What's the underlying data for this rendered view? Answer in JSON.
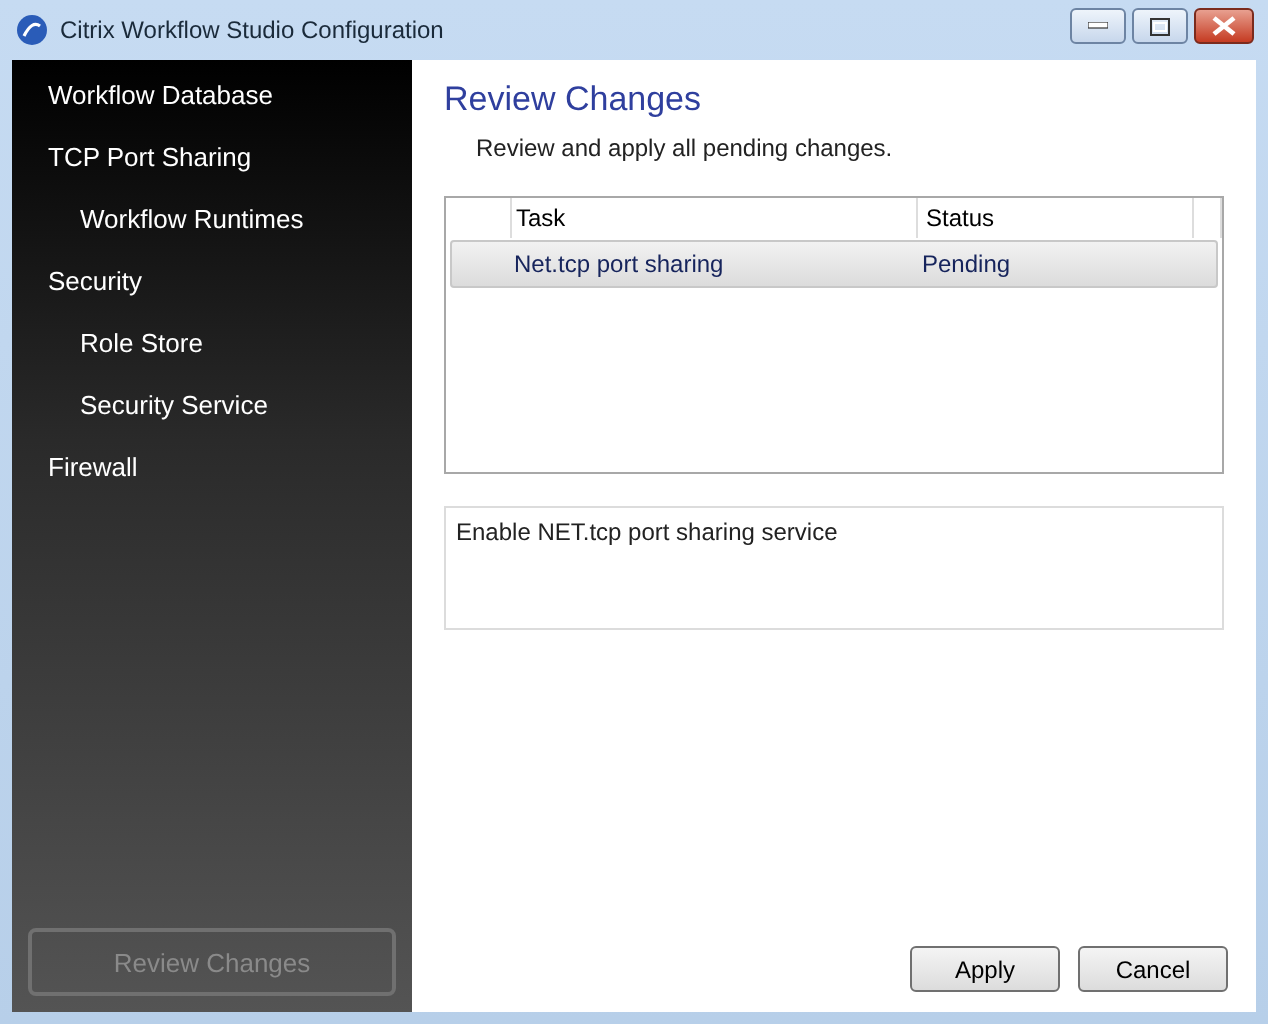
{
  "window": {
    "title": "Citrix Workflow Studio Configuration"
  },
  "sidebar": {
    "items": [
      {
        "label": "Workflow Database"
      },
      {
        "label": "TCP Port Sharing",
        "children": [
          {
            "label": "Workflow Runtimes"
          }
        ]
      },
      {
        "label": "Security",
        "children": [
          {
            "label": "Role Store"
          },
          {
            "label": "Security Service"
          }
        ]
      },
      {
        "label": "Firewall"
      }
    ],
    "button": {
      "label": "Review Changes",
      "disabled": true
    }
  },
  "page": {
    "title": "Review Changes",
    "subtitle": "Review and apply all pending changes.",
    "table": {
      "columns": [
        "Task",
        "Status"
      ],
      "rows": [
        {
          "cells": [
            "Net.tcp port sharing",
            "Pending"
          ],
          "selected": true
        }
      ]
    },
    "description": "Enable NET.tcp port sharing service"
  },
  "buttons": [
    "Apply",
    "Cancel"
  ]
}
